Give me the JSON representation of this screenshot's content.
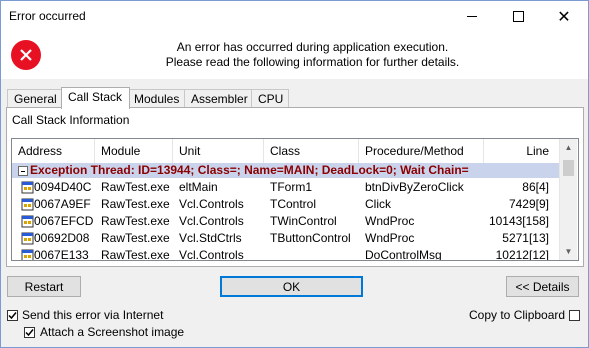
{
  "window": {
    "title": "Error occurred",
    "minimize_glyph": "—",
    "close_glyph": "✕"
  },
  "header": {
    "icon": "error-icon",
    "line1": "An error has occurred during application execution.",
    "line2": "Please read the following information for further details."
  },
  "tabs": [
    {
      "label": "General",
      "active": false
    },
    {
      "label": "Call Stack",
      "active": true
    },
    {
      "label": "Modules",
      "active": false
    },
    {
      "label": "Assembler",
      "active": false
    },
    {
      "label": "CPU",
      "active": false
    }
  ],
  "panel": {
    "title": "Call Stack Information"
  },
  "grid": {
    "columns": [
      "Address",
      "Module",
      "Unit",
      "Class",
      "Procedure/Method",
      "Line"
    ],
    "thread_row": "Exception Thread: ID=13944; Class=; Name=MAIN; DeadLock=0; Wait Chain=",
    "rows": [
      {
        "address": "0094D40C",
        "module": "RawTest.exe",
        "unit": "eltMain",
        "class": "TForm1",
        "method": "btnDivByZeroClick",
        "line": "86[4]"
      },
      {
        "address": "0067A9EF",
        "module": "RawTest.exe",
        "unit": "Vcl.Controls",
        "class": "TControl",
        "method": "Click",
        "line": "7429[9]"
      },
      {
        "address": "0067EFCD",
        "module": "RawTest.exe",
        "unit": "Vcl.Controls",
        "class": "TWinControl",
        "method": "WndProc",
        "line": "10143[158]"
      },
      {
        "address": "00692D08",
        "module": "RawTest.exe",
        "unit": "Vcl.StdCtrls",
        "class": "TButtonControl",
        "method": "WndProc",
        "line": "5271[13]"
      },
      {
        "address": "0067E133",
        "module": "RawTest.exe",
        "unit": "Vcl.Controls",
        "class": "",
        "method": "DoControlMsg",
        "line": "10212[12]"
      }
    ],
    "scroll_up": "▲",
    "scroll_down": "▼"
  },
  "buttons": {
    "restart": "Restart",
    "ok": "OK",
    "details": "<< Details"
  },
  "options": {
    "send_internet": {
      "label": "Send this error via Internet",
      "checked": true
    },
    "attach_screenshot": {
      "label": "Attach a Screenshot image",
      "checked": true
    },
    "copy_clipboard": {
      "label": "Copy to Clipboard",
      "checked": false
    }
  },
  "colors": {
    "thread_row_bg": "#c9d3ec",
    "thread_row_text": "#8b0000",
    "error_icon": "#e81123",
    "default_button_border": "#0078d7"
  }
}
